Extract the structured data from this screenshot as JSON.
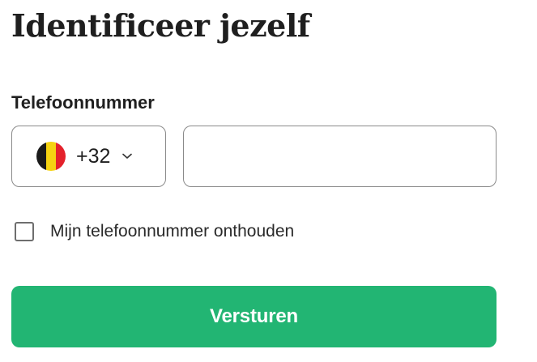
{
  "page": {
    "title": "Identificeer jezelf"
  },
  "phone": {
    "label": "Telefoonnummer",
    "country": {
      "flag_icon": "belgium-flag-icon",
      "flag_colors": [
        "#1a1a1a",
        "#f5d211",
        "#e4212b"
      ],
      "dial_code": "+32",
      "dropdown_icon": "chevron-down-icon"
    },
    "input_value": "",
    "placeholder": ""
  },
  "remember": {
    "checked": false,
    "label": "Mijn telefoonnummer onthouden"
  },
  "submit": {
    "label": "Versturen",
    "color": "#22b573"
  }
}
